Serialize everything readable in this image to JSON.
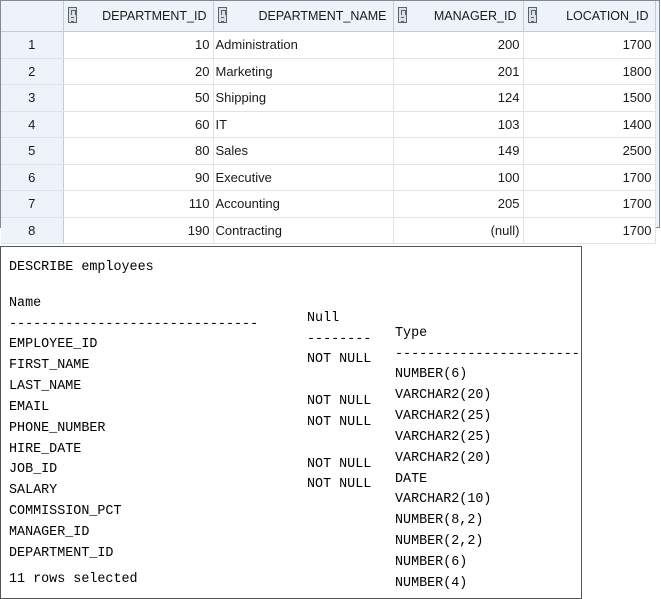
{
  "result_grid": {
    "columns": [
      "DEPARTMENT_ID",
      "DEPARTMENT_NAME",
      "MANAGER_ID",
      "LOCATION_ID"
    ],
    "rows": [
      {
        "n": "1",
        "department_id": "10",
        "department_name": "Administration",
        "manager_id": "200",
        "location_id": "1700"
      },
      {
        "n": "2",
        "department_id": "20",
        "department_name": "Marketing",
        "manager_id": "201",
        "location_id": "1800"
      },
      {
        "n": "3",
        "department_id": "50",
        "department_name": "Shipping",
        "manager_id": "124",
        "location_id": "1500"
      },
      {
        "n": "4",
        "department_id": "60",
        "department_name": "IT",
        "manager_id": "103",
        "location_id": "1400"
      },
      {
        "n": "5",
        "department_id": "80",
        "department_name": "Sales",
        "manager_id": "149",
        "location_id": "2500"
      },
      {
        "n": "6",
        "department_id": "90",
        "department_name": "Executive",
        "manager_id": "100",
        "location_id": "1700"
      },
      {
        "n": "7",
        "department_id": "110",
        "department_name": "Accounting",
        "manager_id": "205",
        "location_id": "1700"
      },
      {
        "n": "8",
        "department_id": "190",
        "department_name": "Contracting",
        "manager_id": "(null)",
        "location_id": "1700"
      }
    ]
  },
  "describe": {
    "command": "DESCRIBE employees",
    "headers": {
      "name": "Name",
      "null": "Null",
      "type": "Type"
    },
    "separator": {
      "name": "-------------------------------",
      "null": "--------",
      "type": "----------------------------"
    },
    "rows": [
      {
        "name": "EMPLOYEE_ID",
        "null": "NOT NULL",
        "type": "NUMBER(6)"
      },
      {
        "name": "FIRST_NAME",
        "null": "",
        "type": "VARCHAR2(20)"
      },
      {
        "name": "LAST_NAME",
        "null": "NOT NULL",
        "type": "VARCHAR2(25)"
      },
      {
        "name": "EMAIL",
        "null": "NOT NULL",
        "type": "VARCHAR2(25)"
      },
      {
        "name": "PHONE_NUMBER",
        "null": "",
        "type": "VARCHAR2(20)"
      },
      {
        "name": "HIRE_DATE",
        "null": "NOT NULL",
        "type": "DATE"
      },
      {
        "name": "JOB_ID",
        "null": "NOT NULL",
        "type": "VARCHAR2(10)"
      },
      {
        "name": "SALARY",
        "null": "",
        "type": "NUMBER(8,2)"
      },
      {
        "name": "COMMISSION_PCT",
        "null": "",
        "type": "NUMBER(2,2)"
      },
      {
        "name": "MANAGER_ID",
        "null": "",
        "type": "NUMBER(6)"
      },
      {
        "name": "DEPARTMENT_ID",
        "null": "",
        "type": "NUMBER(4)"
      }
    ],
    "footer": "11 rows selected"
  }
}
